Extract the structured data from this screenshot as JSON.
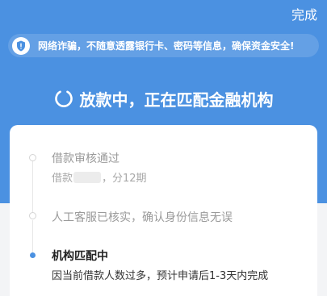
{
  "header": {
    "done_label": "完成",
    "background": "#4b91e1"
  },
  "notice": {
    "icon": "shield-icon",
    "text": "网络诈骗，不随意透露银行卡、密码等信息，确保资金安全!"
  },
  "status": {
    "icon": "loading-spinner-icon",
    "title": "放款中，正在匹配金融机构"
  },
  "progress": {
    "steps": [
      {
        "title": "借款审核通过",
        "desc_prefix": "借款",
        "desc_suffix": "，分12期",
        "state": "done"
      },
      {
        "title": "人工客服已核实，确认身份信息无误",
        "state": "done"
      },
      {
        "title": "机构匹配中",
        "desc": "因当前借款人数过多，预计申请后1-3天内完成",
        "state": "active"
      }
    ]
  },
  "colors": {
    "accent": "#4b91e1",
    "muted_text": "#9a9a9a",
    "dark_text": "#222222"
  }
}
